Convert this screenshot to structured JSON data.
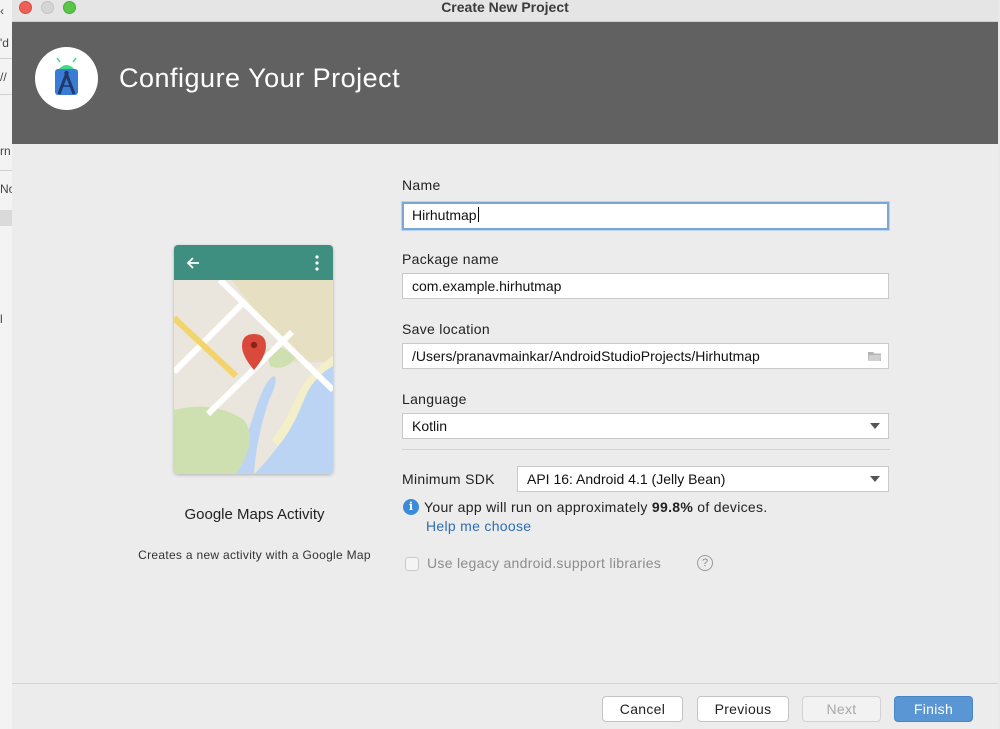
{
  "window": {
    "title": "Create New Project"
  },
  "header": {
    "title": "Configure Your Project",
    "logo_icon": "android-studio-icon"
  },
  "background_fragments": [
    "'d",
    "//",
    "rn",
    "No",
    "l"
  ],
  "template": {
    "name": "Google Maps Activity",
    "description": "Creates a new activity with a Google Map",
    "bar_color": "#3f8f80"
  },
  "form": {
    "name_label": "Name",
    "name_value": "Hirhutmap",
    "package_label": "Package name",
    "package_value": "com.example.hirhutmap",
    "save_label": "Save location",
    "save_value": "/Users/pranavmainkar/AndroidStudioProjects/Hirhutmap",
    "language_label": "Language",
    "language_value": "Kotlin",
    "sdk_label": "Minimum SDK",
    "sdk_value": "API 16: Android 4.1 (Jelly Bean)"
  },
  "info": {
    "text_prefix": "Your app will run on approximately ",
    "percent": "99.8%",
    "text_suffix": " of devices.",
    "help_link": "Help me choose"
  },
  "legacy": {
    "label": "Use legacy android.support libraries",
    "checked": false
  },
  "buttons": {
    "cancel": "Cancel",
    "previous": "Previous",
    "next": "Next",
    "finish": "Finish"
  },
  "colors": {
    "accent": "#5a96d3",
    "header_bg": "#616161",
    "link": "#2e6db5"
  }
}
